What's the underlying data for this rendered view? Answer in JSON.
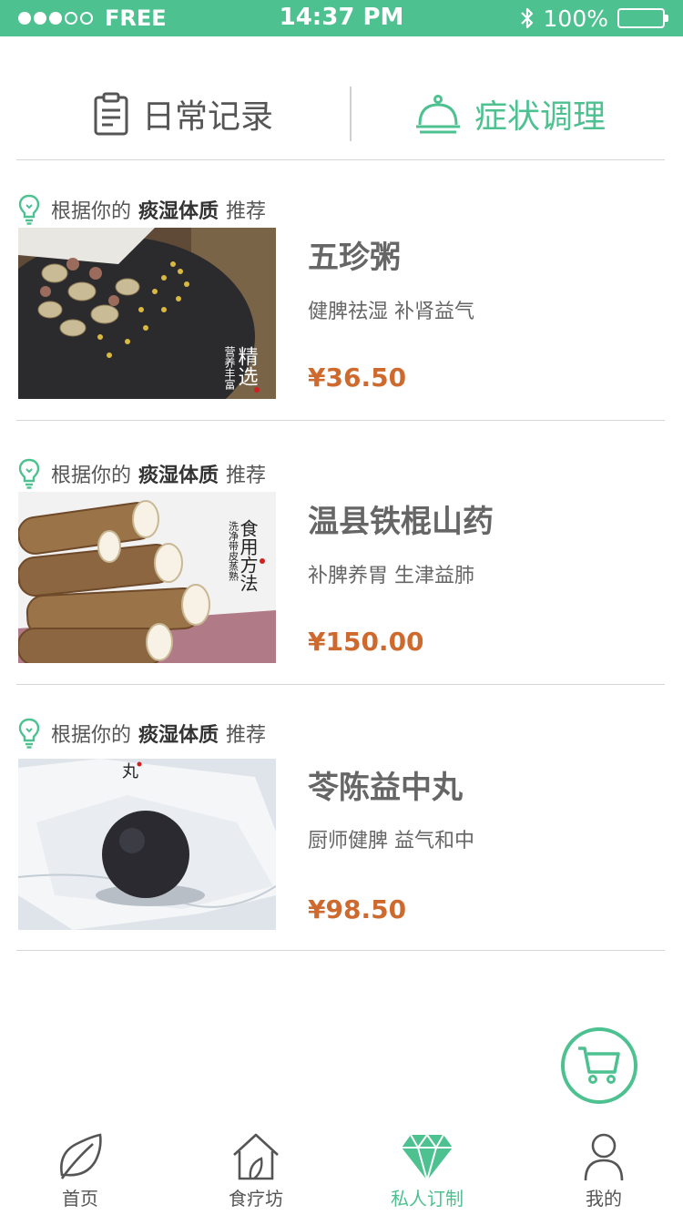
{
  "status_bar": {
    "carrier": "FREE",
    "time": "14:37 PM",
    "battery": "100%"
  },
  "tabs": {
    "daily": "日常记录",
    "symptom": "症状调理",
    "active": "symptom"
  },
  "products": [
    {
      "rec_prefix": "根据你的",
      "rec_bold": "痰湿体质",
      "rec_suffix": "推荐",
      "name": "五珍粥",
      "desc": "健脾祛湿 补肾益气",
      "price": "¥36.50",
      "image_caption": "精选",
      "image_caption2": "营养丰富"
    },
    {
      "rec_prefix": "根据你的",
      "rec_bold": "痰湿体质",
      "rec_suffix": "推荐",
      "name": "温县铁棍山药",
      "desc": "补脾养胃 生津益肺",
      "price": "¥150.00",
      "image_caption": "食用方法",
      "image_caption2": "洗净带皮蒸熟"
    },
    {
      "rec_prefix": "根据你的",
      "rec_bold": "痰湿体质",
      "rec_suffix": "推荐",
      "name": "苓陈益中丸",
      "desc": "厨师健脾 益气和中",
      "price": "¥98.50",
      "image_caption": "丸"
    }
  ],
  "tabbar": {
    "items": [
      "首页",
      "食疗坊",
      "私人订制",
      "我的"
    ],
    "active_index": 2
  },
  "colors": {
    "accent": "#4dc190",
    "price": "#cf6a2f",
    "text": "#555555"
  }
}
